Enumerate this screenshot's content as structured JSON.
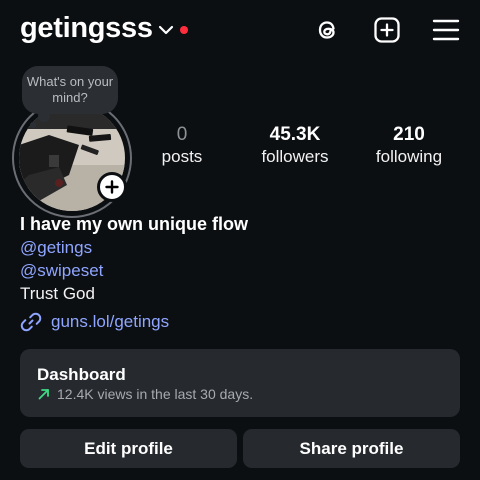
{
  "header": {
    "username": "getingsss",
    "has_unread_dot": true,
    "icons": [
      "threads-icon",
      "create-post-icon",
      "menu-icon"
    ]
  },
  "note": {
    "text": "What's on your mind?"
  },
  "stats": {
    "posts": {
      "value": "0",
      "label": "posts"
    },
    "followers": {
      "value": "45.3K",
      "label": "followers"
    },
    "following": {
      "value": "210",
      "label": "following"
    }
  },
  "bio": {
    "name": "I have my own unique flow",
    "mentions": [
      "@getings",
      "@swipeset"
    ],
    "text": "Trust God",
    "link": "guns.lol/getings"
  },
  "dashboard": {
    "title": "Dashboard",
    "subtitle": "12.4K views in the last 30 days."
  },
  "actions": {
    "edit": "Edit profile",
    "share": "Share profile"
  },
  "colors": {
    "background": "#0c0f12",
    "card": "#262a2f",
    "link": "#8fa5ff",
    "trend": "#3ddc84",
    "notification_dot": "#ff2d3d"
  }
}
